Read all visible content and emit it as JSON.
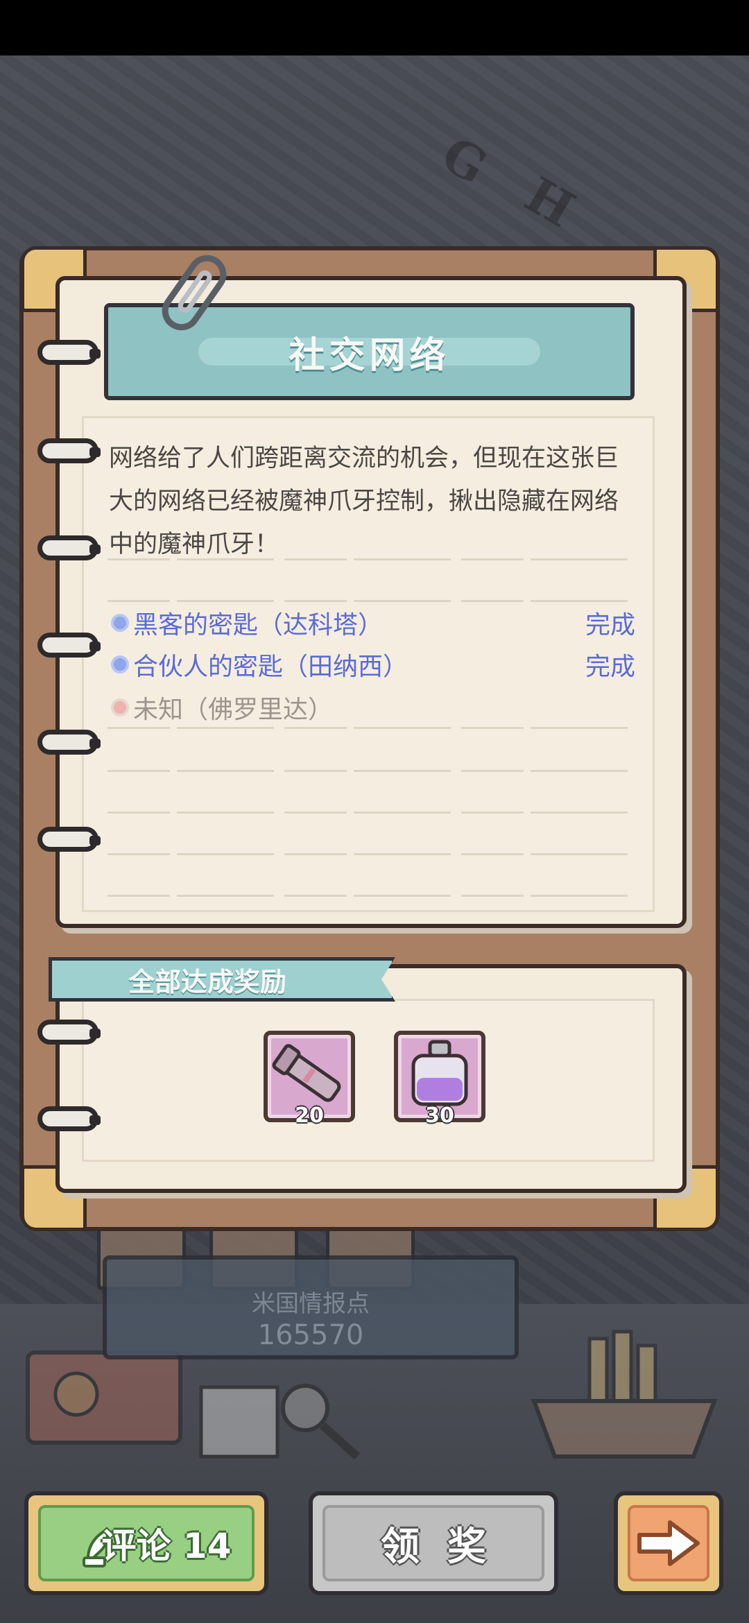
{
  "quest": {
    "title": "社交网络",
    "description": "网络给了人们跨距离交流的机会，但现在这张巨大的网络已经被魔神爪牙控制，揪出隐藏在网络中的魔神爪牙！",
    "tasks": [
      {
        "label": "黑客的密匙（达科塔）",
        "status": "完成",
        "state": "done"
      },
      {
        "label": "合伙人的密匙（田纳西）",
        "status": "完成",
        "state": "done"
      },
      {
        "label": "未知（佛罗里达）",
        "status": "",
        "state": "unknown"
      }
    ]
  },
  "rewards": {
    "header": "全部达成奖励",
    "items": [
      {
        "icon": "telescope-icon",
        "count": "20"
      },
      {
        "icon": "potion-bottle-icon",
        "count": "30"
      }
    ]
  },
  "location": {
    "name": "米国情报点",
    "value": "165570"
  },
  "buttons": {
    "comment_label": "评论 14",
    "claim_label": "领奖",
    "next_icon": "arrow-right-icon"
  },
  "colors": {
    "banner": "#8fc2c3",
    "task_done": "#5b6bd8",
    "task_unknown": "#9c948e",
    "comment_button": "#98cf83",
    "next_button": "#f0a472"
  }
}
